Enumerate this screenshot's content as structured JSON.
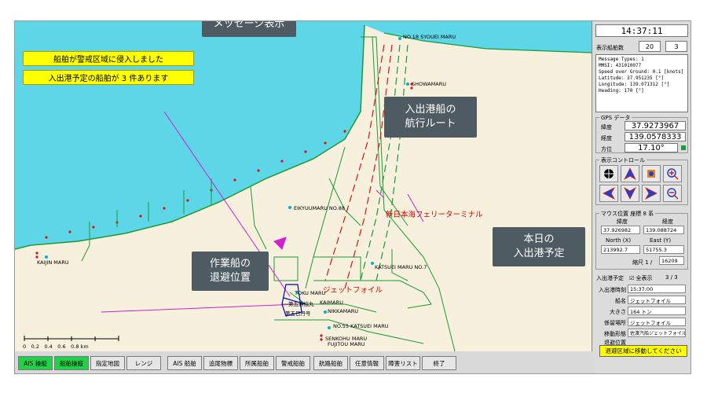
{
  "callouts": {
    "message": "メッセージ表示",
    "route_l1": "入出港船の",
    "route_l2": "航行ルート",
    "work_l1": "作業船の",
    "work_l2": "退避位置",
    "today_l1": "本日の",
    "today_l2": "入出港予定"
  },
  "alerts": [
    "船舶が警戒区域に侵入しました",
    "入出港予定の船舶が 3 件あります"
  ],
  "map_labels": {
    "ships": [
      "NO.18 SYOUEI MARU",
      "SHOWAMARU",
      "EIKYUUMARU NO.88",
      "KATSUEI MARU NO.7",
      "KAIJIN MARU",
      "TOKU MARU",
      "第五漁協丸",
      "KAIMARU",
      "第五日丹号",
      "NIKKAMARU",
      "NO.55 KATSUEI MARU",
      "SENKOHU MARU",
      "FUJITOU MARU"
    ],
    "terminal": "新日本海フェリーターミナル",
    "ferry": "ジェットフォイル"
  },
  "scale": {
    "ticks": "0　0.2　0.4　0.6　0.8 km"
  },
  "panel": {
    "time": "14:37:11",
    "ship_count_label": "表示船舶数",
    "ship_count_a": "20",
    "ship_count_b": "3",
    "message_lines": [
      "Message Types: 1",
      "MMSI: 431010077",
      "Speed over Ground: 0.1 [knots]",
      "Latitude: 37.951235 [°]",
      "Longitude: 139.071312 [°]",
      "Heading: 170 [°]"
    ],
    "gps_title": "GPS データ",
    "lat_label": "緯度",
    "lat_value": "37.9273967",
    "lon_label": "経度",
    "lon_value": "139.0578333",
    "heading_label": "方位",
    "heading_value": "17.10°",
    "control_title": "表示コントロール",
    "mouse_title": "マウス位置 座標 8 系",
    "m_lat_label": "緯度",
    "m_lon_label": "経度",
    "m_lat": "37.926982",
    "m_lon": "139.088724",
    "north_label": "North (X)",
    "east_label": "East (Y)",
    "north": "213992.7",
    "east": "51755.3",
    "scale_label": "縮尺 1 /",
    "scale_value": "16209",
    "sched_label": "入出港予定",
    "sched_check": "☑ 全表示",
    "sched_count": "3 / 3",
    "eta_label": "入出港時刻",
    "eta_value": "15:37:00",
    "ship_name_label": "船名",
    "ship_name": "ジェットフォイル",
    "size_label": "大きさ",
    "size_value": "164 トン",
    "berth_label": "係留場所",
    "berth_value": "ジェットフォイル",
    "move_label": "移動形態",
    "move_value": "佐渡汽船ジェットフォイル",
    "evac_label": "退避位置",
    "evac_value": "",
    "move_button": "退避区域に移動してください"
  },
  "toolbar": [
    "AIS 操縦",
    "船舶操縦",
    "指定地図",
    "レンジ",
    "AIS 船舶",
    "追尾物標",
    "所属船舶",
    "警戒船舶",
    "航路船舶",
    "任意情報",
    "障害リスト",
    "終了"
  ],
  "colors": {
    "sea": "#5dd6e8",
    "land": "#f6f0dc",
    "alert": "#ffff00",
    "callout": "#4f5b62",
    "active": "#22d14a"
  }
}
